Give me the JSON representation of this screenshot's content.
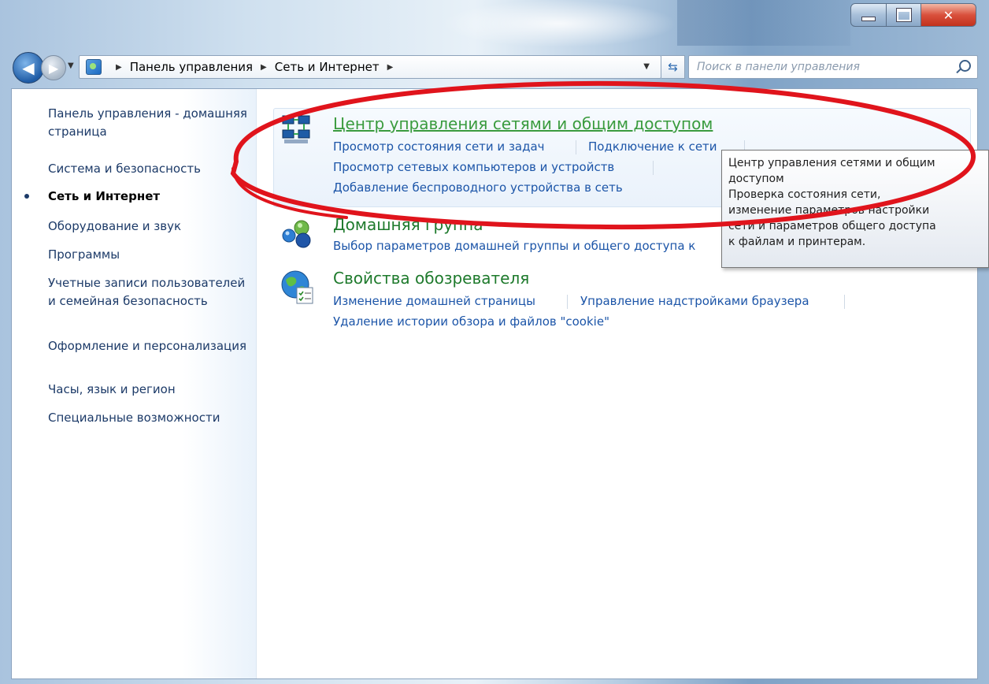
{
  "window": {
    "caption_buttons": [
      "minimize",
      "maximize",
      "close"
    ]
  },
  "navbar": {
    "breadcrumbs": [
      "Панель управления",
      "Сеть и Интернет"
    ],
    "search_placeholder": "Поиск в панели управления"
  },
  "sidebar": {
    "items": [
      {
        "label": "Панель управления - домашняя страница",
        "active": false
      },
      {
        "label": "Система и безопасность",
        "active": false
      },
      {
        "label": "Сеть и Интернет",
        "active": true
      },
      {
        "label": "Оборудование и звук",
        "active": false
      },
      {
        "label": "Программы",
        "active": false
      },
      {
        "label": "Учетные записи пользователей и семейная безопасность",
        "active": false
      },
      {
        "label": "Оформление и персонализация",
        "active": false
      },
      {
        "label": "Часы, язык и регион",
        "active": false
      },
      {
        "label": "Специальные возможности",
        "active": false
      }
    ]
  },
  "categories": [
    {
      "title": "Центр управления сетями и общим доступом",
      "icon": "network-center-icon",
      "links": [
        "Просмотр состояния сети и задач",
        "Подключение к сети",
        "Просмотр сетевых компьютеров и устройств",
        "Добавление беспроводного устройства в сеть"
      ]
    },
    {
      "title": "Домашняя группа",
      "icon": "homegroup-icon",
      "links": [
        "Выбор параметров домашней группы и общего доступа к"
      ]
    },
    {
      "title": "Свойства обозревателя",
      "icon": "internet-options-icon",
      "links": [
        "Изменение домашней страницы",
        "Управление надстройками браузера",
        "Удаление истории обзора и файлов \"cookie\""
      ]
    }
  ],
  "tooltip": {
    "lines": [
      "Центр управления сетями и общим",
      "доступом",
      "Проверка состояния сети,",
      "изменение параметров настройки",
      "сети и параметров общего доступа",
      "к файлам и принтерам."
    ]
  },
  "colors": {
    "link": "#1c55a8",
    "category_title": "#1e7a2c",
    "annotation": "#e0141c"
  }
}
